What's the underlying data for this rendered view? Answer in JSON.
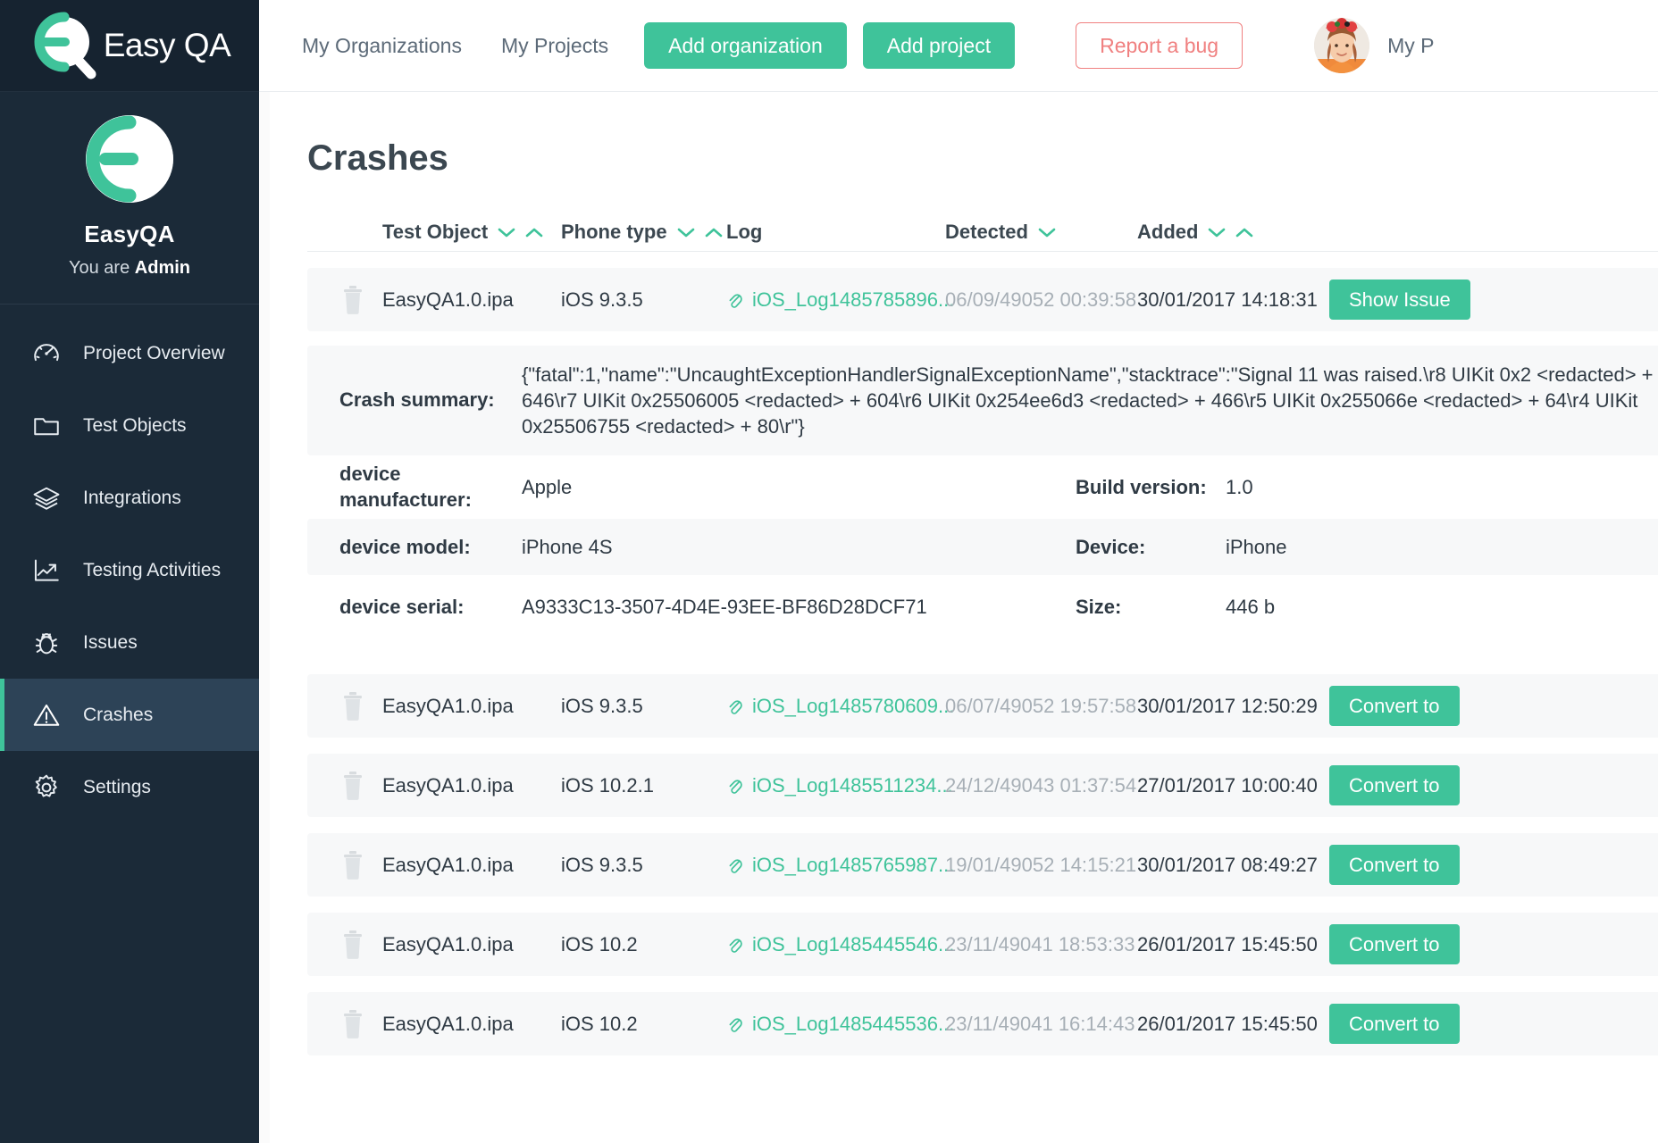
{
  "brand": {
    "name": "Easy QA",
    "logo_icon": "easyqa-logo-icon"
  },
  "sidebar": {
    "project": {
      "name": "EasyQA",
      "role_prefix": "You are ",
      "role": "Admin",
      "avatar_icon": "project-avatar-icon"
    },
    "items": [
      {
        "label": "Project Overview",
        "icon": "gauge-icon",
        "active": false
      },
      {
        "label": "Test Objects",
        "icon": "folder-icon",
        "active": false
      },
      {
        "label": "Integrations",
        "icon": "layers-icon",
        "active": false
      },
      {
        "label": "Testing Activities",
        "icon": "chart-line-icon",
        "active": false
      },
      {
        "label": "Issues",
        "icon": "bug-icon",
        "active": false
      },
      {
        "label": "Crashes",
        "icon": "warning-triangle-icon",
        "active": true
      },
      {
        "label": "Settings",
        "icon": "gear-icon",
        "active": false
      }
    ]
  },
  "topbar": {
    "links": [
      "My Organizations",
      "My Projects"
    ],
    "add_organization": "Add organization",
    "add_project": "Add project",
    "report_bug": "Report a bug",
    "user_name": "My P",
    "avatar_icon": "user-avatar-icon"
  },
  "page": {
    "title": "Crashes"
  },
  "table": {
    "columns": [
      {
        "label": "Test Object",
        "sorters": [
          "down",
          "up"
        ]
      },
      {
        "label": "Phone type",
        "sorters": [
          "down",
          "up"
        ]
      },
      {
        "label": "Log",
        "sorters": []
      },
      {
        "label": "Detected",
        "sorters": [
          "down"
        ]
      },
      {
        "label": "Added",
        "sorters": [
          "down",
          "up"
        ]
      }
    ],
    "rows": [
      {
        "object": "EasyQA1.0.ipa",
        "phone": "iOS 9.3.5",
        "log": "iOS_Log1485785896...",
        "detected": "06/09/49052 00:39:58",
        "added": "30/01/2017 14:18:31",
        "action": "Show Issue"
      },
      {
        "object": "EasyQA1.0.ipa",
        "phone": "iOS 9.3.5",
        "log": "iOS_Log1485780609...",
        "detected": "06/07/49052 19:57:58",
        "added": "30/01/2017 12:50:29",
        "action": "Convert to"
      },
      {
        "object": "EasyQA1.0.ipa",
        "phone": "iOS 10.2.1",
        "log": "iOS_Log1485511234...",
        "detected": "24/12/49043 01:37:54",
        "added": "27/01/2017 10:00:40",
        "action": "Convert to"
      },
      {
        "object": "EasyQA1.0.ipa",
        "phone": "iOS 9.3.5",
        "log": "iOS_Log1485765987...",
        "detected": "19/01/49052 14:15:21",
        "added": "30/01/2017 08:49:27",
        "action": "Convert to"
      },
      {
        "object": "EasyQA1.0.ipa",
        "phone": "iOS 10.2",
        "log": "iOS_Log1485445546...",
        "detected": "23/11/49041 18:53:33",
        "added": "26/01/2017 15:45:50",
        "action": "Convert to"
      },
      {
        "object": "EasyQA1.0.ipa",
        "phone": "iOS 10.2",
        "log": "iOS_Log1485445536...",
        "detected": "23/11/49041 16:14:43",
        "added": "26/01/2017 15:45:50",
        "action": "Convert to"
      }
    ]
  },
  "detail": {
    "crash_summary_label": "Crash summary:",
    "crash_summary_value": "{\"fatal\":1,\"name\":\"UncaughtExceptionHandlerSignalExceptionName\",\"stacktrace\":\"Signal 11 was raised.\\r8 UIKit 0x2 <redacted> + 646\\r7 UIKit 0x25506005 <redacted> + 604\\r6 UIKit 0x254ee6d3 <redacted> + 466\\r5 UIKit 0x255066e <redacted> + 64\\r4 UIKit 0x25506755 <redacted> + 80\\r\"}",
    "fields": [
      {
        "label": "device manufacturer:",
        "value": "Apple",
        "label2": "Build version:",
        "value2": "1.0"
      },
      {
        "label": "device model:",
        "value": "iPhone 4S",
        "label2": "Device:",
        "value2": "iPhone"
      },
      {
        "label": "device serial:",
        "value": "A9333C13-3507-4D4E-93EE-BF86D28DCF71",
        "label2": "Size:",
        "value2": "446 b"
      }
    ]
  },
  "colors": {
    "accent": "#3fc39a",
    "danger": "#f08080",
    "sidebar_bg": "#1b2a38",
    "sidebar_active_bg": "#2d4357",
    "row_bg": "#f7f8f9",
    "text": "#2f3a44",
    "muted": "#a7afb6"
  }
}
